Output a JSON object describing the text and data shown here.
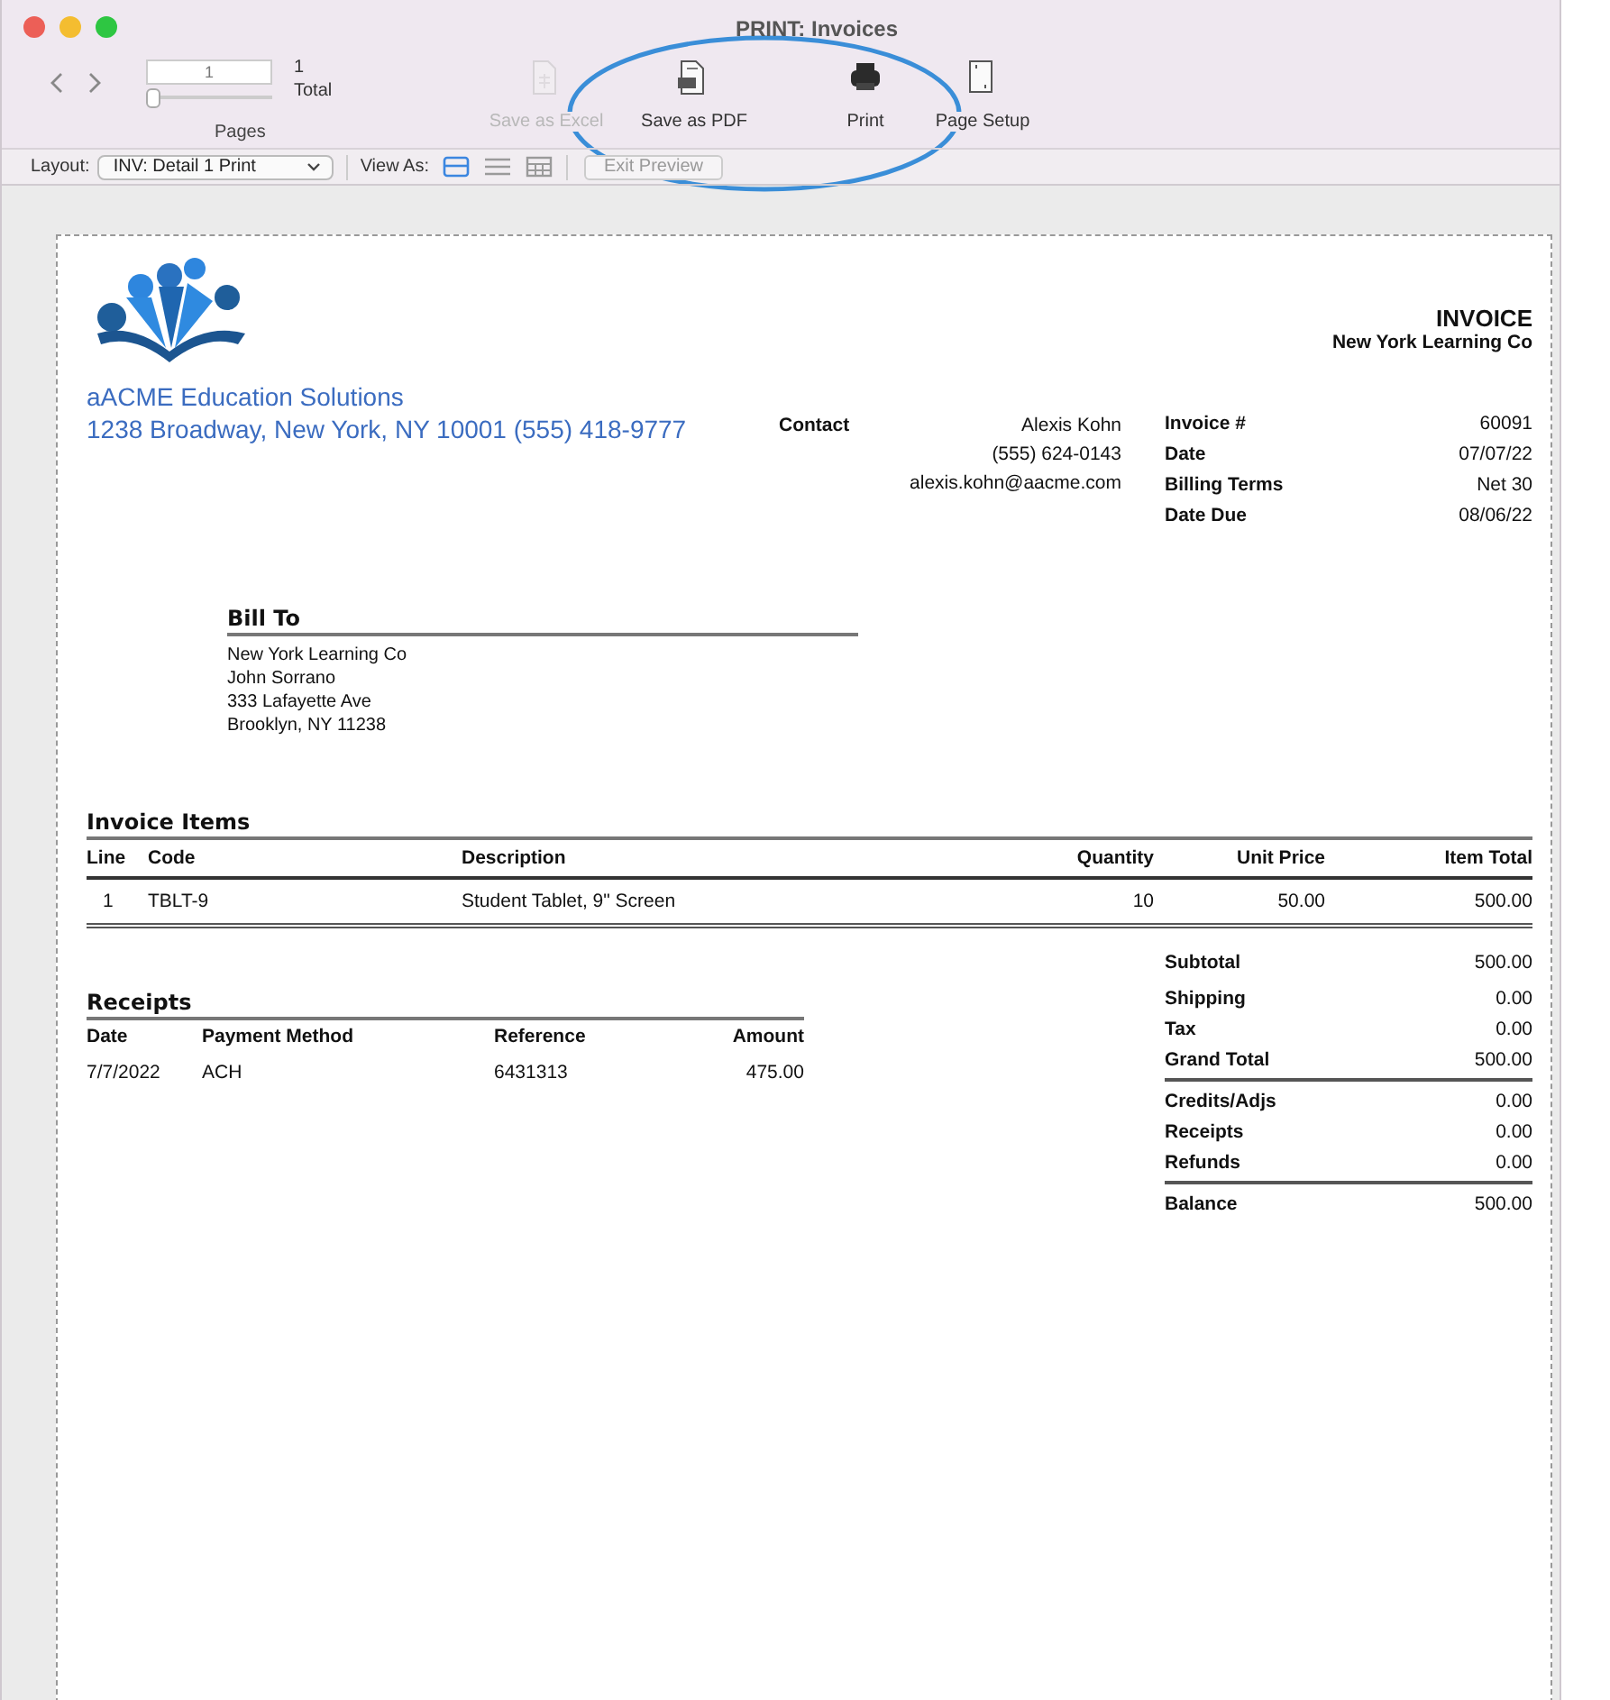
{
  "window": {
    "title": "PRINT: Invoices"
  },
  "toolbar": {
    "page_field": {
      "value": "1"
    },
    "page_slider": {
      "level": 0
    },
    "page_count": "1",
    "page_count_label": "Total",
    "pages_label": "Pages",
    "buttons": [
      {
        "label": "Save as Excel",
        "kind": "excel",
        "disabled": true
      },
      {
        "label": "Save as PDF",
        "kind": "pdf",
        "disabled": false
      },
      {
        "label": "Print",
        "kind": "print",
        "disabled": false
      },
      {
        "label": "Page Setup",
        "kind": "setup",
        "disabled": false
      }
    ]
  },
  "layout_bar": {
    "layout_label": "Layout:",
    "layout_value": "INV: Detail 1 Print",
    "view_as_label": "View As:",
    "views": [
      {
        "kind": "form",
        "selected": true
      },
      {
        "kind": "list",
        "selected": false
      },
      {
        "kind": "table",
        "selected": false
      }
    ],
    "exit_button": {
      "label": "Exit Preview",
      "disabled": true
    }
  },
  "annotation": {
    "kind": "ellipse"
  },
  "invoice": {
    "company": {
      "name": "aACME Education Solutions",
      "address": "1238 Broadway, New York, NY 10001 (555) 418-9777"
    },
    "title": "INVOICE",
    "customer": "New York Learning Co",
    "contact": {
      "label": "Contact",
      "lines": [
        "Alexis Kohn",
        "(555) 624-0143",
        "alexis.kohn@aacme.com"
      ]
    },
    "details": [
      {
        "label": "Invoice #",
        "value": "60091"
      },
      {
        "label": "Date",
        "value": "07/07/22"
      },
      {
        "label": "Billing Terms",
        "value": "Net 30"
      },
      {
        "label": "Date Due",
        "value": "08/06/22"
      }
    ],
    "bill_to": {
      "title": "Bill To",
      "lines": [
        "New York Learning Co",
        "John Sorrano",
        "333 Lafayette Ave",
        "Brooklyn, NY 11238"
      ]
    },
    "items": {
      "title": "Invoice Items",
      "columns": [
        "Line",
        "Code",
        "Description",
        "Quantity",
        "Unit Price",
        "Item Total"
      ],
      "rows": [
        [
          "1",
          "TBLT-9",
          "Student Tablet, 9\" Screen",
          "10",
          "50.00",
          "500.00"
        ]
      ]
    },
    "totals": [
      [
        {
          "label": "Subtotal",
          "value": "500.00"
        },
        {
          "label": "Shipping",
          "value": "0.00"
        },
        {
          "label": "Tax",
          "value": "0.00"
        },
        {
          "label": "Grand Total",
          "value": "500.00"
        }
      ],
      [
        {
          "label": "Credits/Adjs",
          "value": "0.00"
        },
        {
          "label": "Receipts",
          "value": "0.00"
        },
        {
          "label": "Refunds",
          "value": "0.00"
        }
      ],
      [
        {
          "label": "Balance",
          "value": "500.00"
        }
      ]
    ],
    "receipts": {
      "title": "Receipts",
      "columns": [
        "Date",
        "Payment Method",
        "Reference",
        "Amount"
      ],
      "rows": [
        [
          "7/7/2022",
          "ACH",
          "6431313",
          "475.00"
        ]
      ]
    }
  }
}
